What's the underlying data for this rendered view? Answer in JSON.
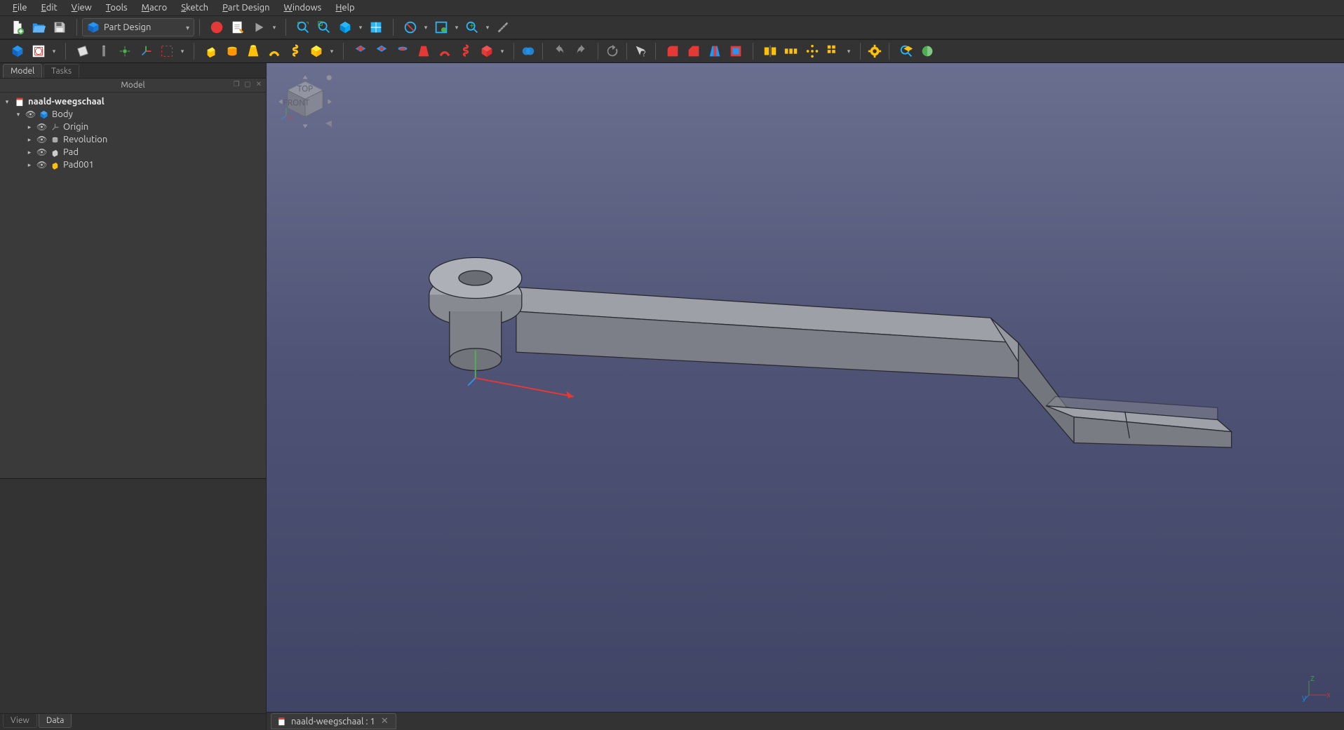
{
  "menu": {
    "file": "File",
    "edit": "Edit",
    "view": "View",
    "tools": "Tools",
    "macro": "Macro",
    "sketch": "Sketch",
    "part_design": "Part Design",
    "windows": "Windows",
    "help": "Help"
  },
  "workbench": {
    "label": "Part Design"
  },
  "side_tabs": {
    "model": "Model",
    "tasks": "Tasks"
  },
  "panel_title": "Model",
  "tree": {
    "root_label": "naald-weegschaal",
    "body_label": "Body",
    "items": [
      {
        "label": "Origin"
      },
      {
        "label": "Revolution"
      },
      {
        "label": "Pad"
      },
      {
        "label": "Pad001"
      }
    ]
  },
  "bottom_tabs": {
    "view": "View",
    "data": "Data"
  },
  "document_tab": {
    "label": "naald-weegschaal : 1"
  },
  "navcube": {
    "top": "TOP",
    "front": "FRONT"
  }
}
